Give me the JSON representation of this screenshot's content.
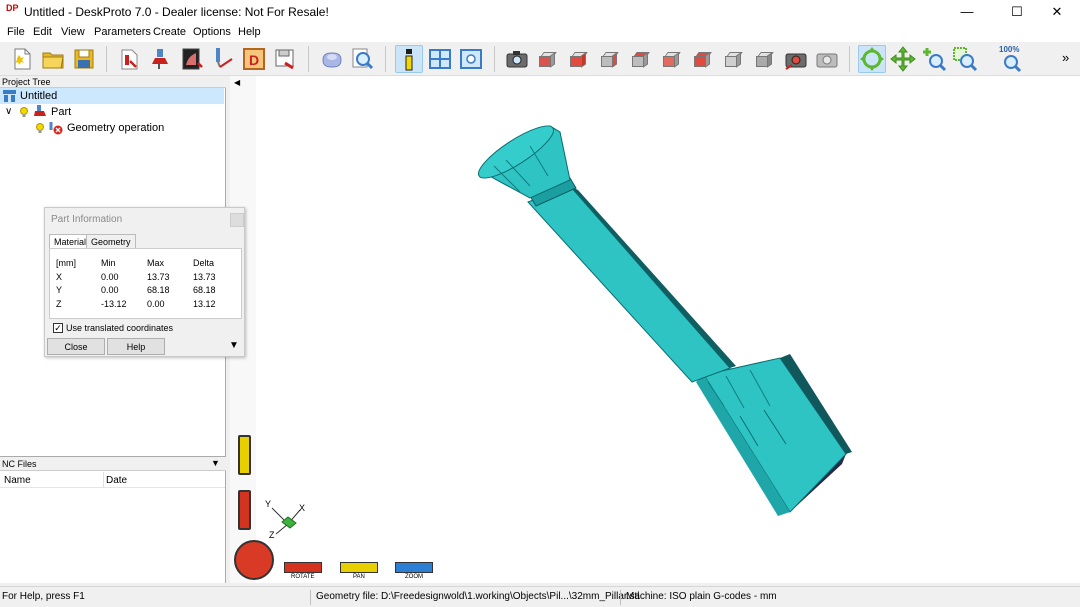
{
  "window": {
    "title": "Untitled - DeskProto 7.0 - Dealer license: Not For Resale!",
    "app_icon_text": "DP"
  },
  "menu": [
    "File",
    "Edit",
    "View",
    "Parameters",
    "Create",
    "Options",
    "Help"
  ],
  "toolbar": {
    "overflow": "»",
    "zoom_label": "100%",
    "selected_tools": [
      "info-icon",
      "rotate-view-icon"
    ]
  },
  "project_tree": {
    "header": "Project Tree",
    "items": [
      {
        "label": "Untitled",
        "selected": true
      },
      {
        "label": "Part"
      },
      {
        "label": "Geometry operation"
      }
    ]
  },
  "part_info": {
    "title": "Part Information",
    "tabs": [
      "Material",
      "Geometry"
    ],
    "active_tab": "Material",
    "columns": [
      "[mm]",
      "Min",
      "Max",
      "Delta"
    ],
    "rows": [
      [
        "X",
        "0.00",
        "13.73",
        "13.73"
      ],
      [
        "Y",
        "0.00",
        "68.18",
        "68.18"
      ],
      [
        "Z",
        "-13.12",
        "0.00",
        "13.12"
      ]
    ],
    "checkbox_label": "Use translated coordinates",
    "checkbox_checked": true,
    "close_label": "Close",
    "help_label": "Help"
  },
  "nc_files": {
    "header": "NC Files",
    "columns": [
      "Name",
      "Date"
    ]
  },
  "viewport": {
    "axes": [
      "Y",
      "X",
      "Z"
    ],
    "controls": [
      "ROTATE",
      "PAN",
      "ZOOM"
    ],
    "model_color": "#2ec4c4"
  },
  "status": {
    "help": "For Help, press F1",
    "geometry_file": "Geometry file: D:\\Freedesignwold\\1.working\\Objects\\Pil...\\32mm_Pillar.stl",
    "machine": "Machine: ISO plain G-codes - mm"
  }
}
